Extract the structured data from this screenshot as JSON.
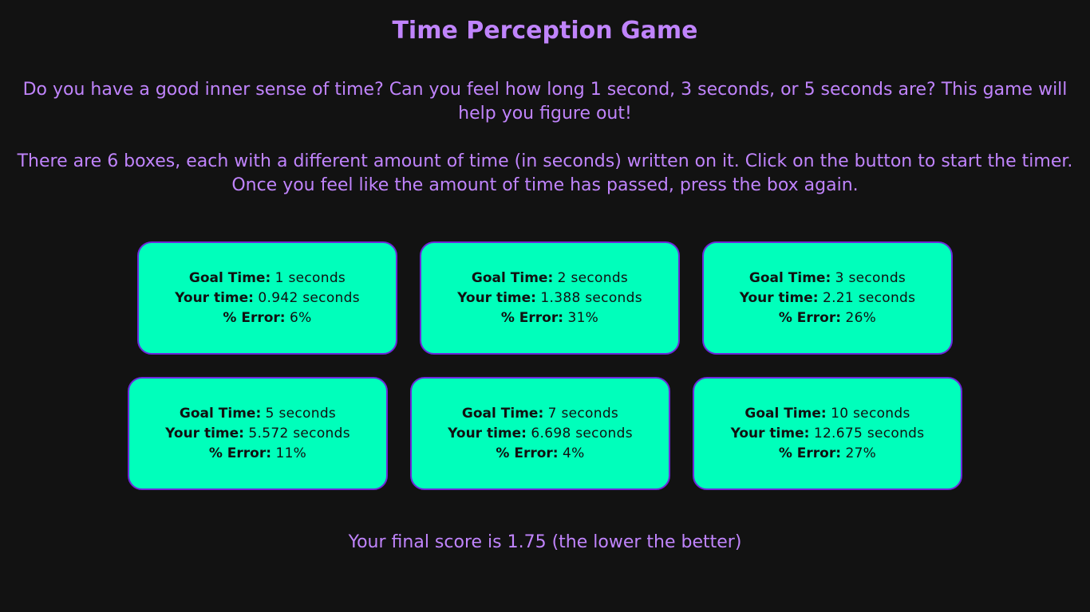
{
  "title": "Time Perception Game",
  "intro": {
    "paragraph1": "Do you have a good inner sense of time? Can you feel how long 1 second, 3 seconds, or 5 seconds are? This game will help you figure out!",
    "paragraph2": "There are 6 boxes, each with a different amount of time (in seconds) written on it. Click on the button to start the timer. Once you feel like the amount of time has passed, press the box again."
  },
  "labels": {
    "goal": "Goal Time:",
    "yours": "Your time:",
    "error": "% Error:"
  },
  "boxes": [
    {
      "goal": "1 seconds",
      "yours": "0.942 seconds",
      "error": "6%"
    },
    {
      "goal": "2 seconds",
      "yours": "1.388 seconds",
      "error": "31%"
    },
    {
      "goal": "3 seconds",
      "yours": "2.21 seconds",
      "error": "26%"
    },
    {
      "goal": "5 seconds",
      "yours": "5.572 seconds",
      "error": "11%"
    },
    {
      "goal": "7 seconds",
      "yours": "6.698 seconds",
      "error": "4%"
    },
    {
      "goal": "10 seconds",
      "yours": "12.675 seconds",
      "error": "27%"
    }
  ],
  "score_text": "Your final score is 1.75 (the lower the better)",
  "colors": {
    "background": "#121212",
    "text_accent": "#c084fc",
    "box_fill": "#00ffbb",
    "box_border": "#6d28d9"
  }
}
